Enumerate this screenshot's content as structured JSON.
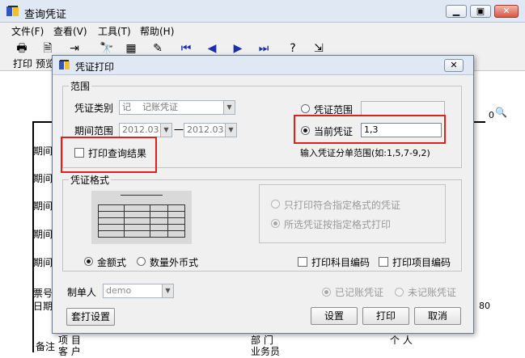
{
  "main_window": {
    "title": "查询凭证",
    "menu": [
      "文件(F)",
      "查看(V)",
      "工具(T)",
      "帮助(H)"
    ],
    "toolbar_labels": [
      "打印",
      "预览"
    ],
    "title_buttons": [
      "minimize-icon",
      "restore-icon",
      "close-icon"
    ],
    "background_text": {
      "rows_left": [
        "期间",
        "期间",
        "期间",
        "期间",
        "期间"
      ],
      "ticket_no": "票号",
      "date": "日期",
      "footer_left": "备注",
      "footer_col1": "项 目",
      "footer_col1b": "客 户",
      "footer_mid": "部 门",
      "footer_mid2": "业务员",
      "footer_right": "个 人",
      "right_zero": "0",
      "right_80": "80"
    }
  },
  "dialog": {
    "title": "凭证打印",
    "scope_group": {
      "label": "范围",
      "voucher_type_label": "凭证类别",
      "voucher_type_value": "记    记账凭证",
      "period_label": "期间范围",
      "period_from": "2012.03",
      "period_sep": "一",
      "period_to": "2012.03",
      "print_query_result": "打印查询结果",
      "voucher_range_label": "凭证范围",
      "voucher_range_value": "",
      "current_voucher_label": "当前凭证",
      "current_voucher_value": "1,3",
      "hint": "输入凭证分单范围(如:1,5,7-9,2)"
    },
    "format_group": {
      "label": "凭证格式",
      "only_matching": "只打印符合指定格式的凭证",
      "print_selected": "所选凭证按指定格式打印",
      "amount_format": "金额式",
      "foreign_format": "数量外币式",
      "print_subject_code": "打印科目编码",
      "print_item_code": "打印项目编码"
    },
    "maker_label": "制单人",
    "maker_value": "demo",
    "posted": "已记账凭证",
    "unposted": "未记账凭证",
    "buttons": {
      "template": "套打设置",
      "settings": "设置",
      "print": "打印",
      "cancel": "取消"
    }
  },
  "colors": {
    "highlight_border": "#e0201b",
    "titlebar": "#dfe8f3",
    "dialog_bg": "#f0f0f0"
  }
}
